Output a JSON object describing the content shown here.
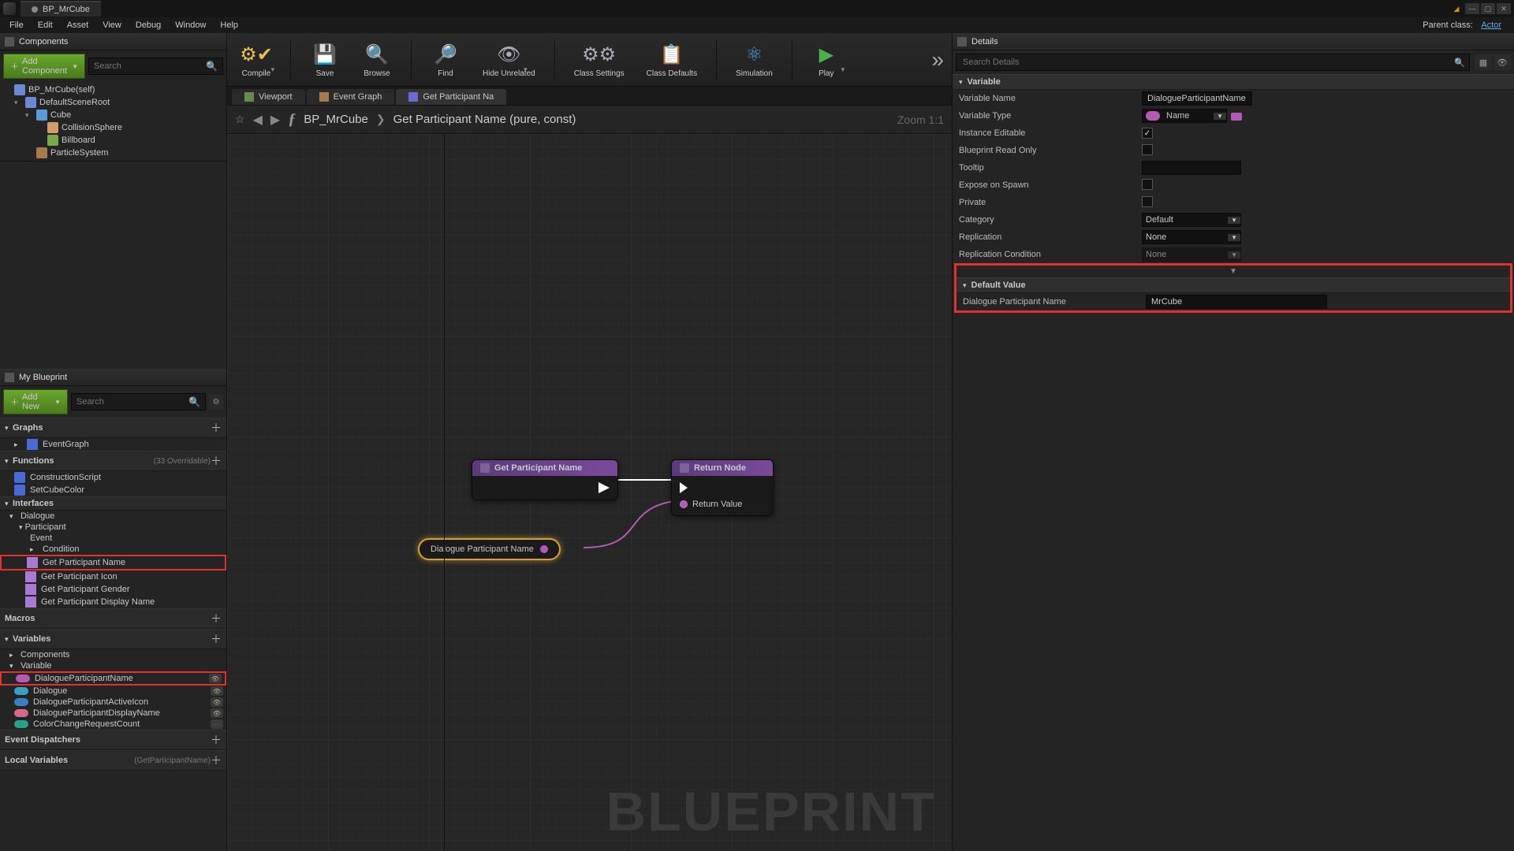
{
  "titlebar": {
    "tab": "BP_MrCube"
  },
  "menu": {
    "file": "File",
    "edit": "Edit",
    "asset": "Asset",
    "view": "View",
    "debug": "Debug",
    "window": "Window",
    "help": "Help",
    "parent_label": "Parent class:",
    "parent_value": "Actor"
  },
  "components": {
    "panel": "Components",
    "add": "Add Component",
    "search_ph": "Search",
    "items": [
      {
        "label": "BP_MrCube(self)",
        "cls": "root",
        "indent": 0
      },
      {
        "label": "DefaultSceneRoot",
        "cls": "root",
        "indent": 1,
        "arr": "▾"
      },
      {
        "label": "Cube",
        "cls": "mesh",
        "indent": 2,
        "arr": "▾"
      },
      {
        "label": "CollisionSphere",
        "cls": "sphere",
        "indent": 3
      },
      {
        "label": "Billboard",
        "cls": "bill",
        "indent": 3
      },
      {
        "label": "ParticleSystem",
        "cls": "part",
        "indent": 2
      }
    ]
  },
  "myblueprint": {
    "panel": "My Blueprint",
    "add": "Add New",
    "search_ph": "Search",
    "sections": {
      "graphs": {
        "title": "Graphs",
        "items": [
          "EventGraph"
        ]
      },
      "functions": {
        "title": "Functions",
        "sub": "(33 Overridable)",
        "items": [
          "ConstructionScript",
          "SetCubeColor"
        ]
      },
      "interfaces": {
        "title": "Interfaces",
        "dialogue": "Dialogue",
        "participant": "Participant",
        "event": "Event",
        "condition": "Condition",
        "items": [
          "Get Participant Name",
          "Get Participant Icon",
          "Get Participant Gender",
          "Get Participant Display Name"
        ]
      },
      "macros": {
        "title": "Macros"
      },
      "variables": {
        "title": "Variables",
        "components": "Components",
        "variable": "Variable",
        "items": [
          {
            "label": "DialogueParticipantName",
            "cls": "name",
            "eye": true,
            "hl": true
          },
          {
            "label": "Dialogue",
            "cls": "dlg",
            "eye": true
          },
          {
            "label": "DialogueParticipantActiveIcon",
            "cls": "tex",
            "eye": true
          },
          {
            "label": "DialogueParticipantDisplayName",
            "cls": "txt",
            "eye": true
          },
          {
            "label": "ColorChangeRequestCount",
            "cls": "int",
            "eye": false
          }
        ]
      },
      "dispatchers": {
        "title": "Event Dispatchers"
      },
      "locals": {
        "title": "Local Variables",
        "sub": "(GetParticipantName)"
      }
    }
  },
  "toolbar": {
    "compile": "Compile",
    "save": "Save",
    "browse": "Browse",
    "find": "Find",
    "hide": "Hide Unrelated",
    "settings": "Class Settings",
    "defaults": "Class Defaults",
    "sim": "Simulation",
    "play": "Play"
  },
  "subtabs": {
    "viewport": "Viewport",
    "event": "Event Graph",
    "func": "Get Participant Na"
  },
  "breadcrumb": {
    "bp": "BP_MrCube",
    "fn": "Get Participant Name (pure, const)",
    "zoom": "Zoom 1:1"
  },
  "nodes": {
    "n1": {
      "title": "Get Participant Name"
    },
    "n2": {
      "title": "Return Node",
      "pin": "Return Value"
    },
    "var": {
      "label": "Dialogue Participant Name"
    }
  },
  "watermark": "BLUEPRINT",
  "details": {
    "panel": "Details",
    "search_ph": "Search Details",
    "variable": {
      "head": "Variable",
      "name_l": "Variable Name",
      "name_v": "DialogueParticipantName",
      "type_l": "Variable Type",
      "type_v": "Name",
      "inst_l": "Instance Editable",
      "inst_v": true,
      "ro_l": "Blueprint Read Only",
      "ro_v": false,
      "tip_l": "Tooltip",
      "tip_v": "",
      "spawn_l": "Expose on Spawn",
      "spawn_v": false,
      "priv_l": "Private",
      "priv_v": false,
      "cat_l": "Category",
      "cat_v": "Default",
      "rep_l": "Replication",
      "rep_v": "None",
      "repc_l": "Replication Condition",
      "repc_v": "None"
    },
    "default": {
      "head": "Default Value",
      "label": "Dialogue Participant Name",
      "value": "MrCube"
    }
  }
}
